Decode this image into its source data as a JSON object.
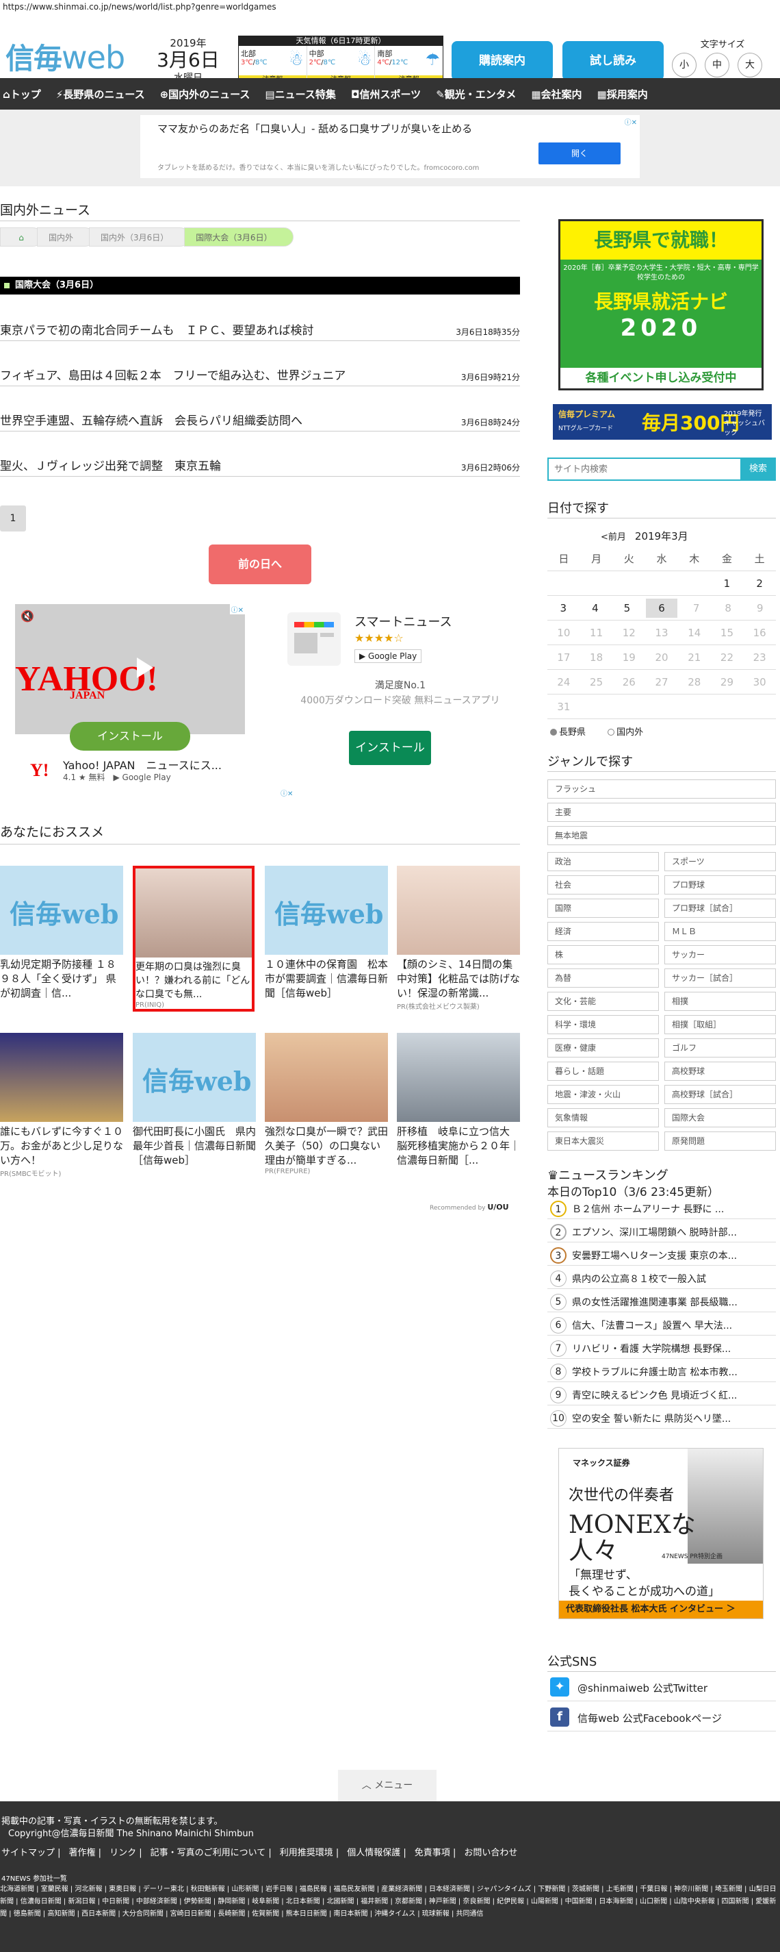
{
  "browser": {
    "url": "https://www.shinmai.co.jp/news/world/list.php?genre=worldgames"
  },
  "header": {
    "logo": "信毎",
    "logo_web": "web",
    "date": {
      "year": "2019年",
      "monthday": "3月6日",
      "weekday": "水曜日"
    },
    "weather": {
      "title": "天気情報（6日17時更新）",
      "regions": [
        {
          "name": "北部",
          "hi": "3℃",
          "lo": "8℃",
          "warn": "注意報"
        },
        {
          "name": "中部",
          "hi": "2℃",
          "lo": "8℃",
          "warn": "注意報"
        },
        {
          "name": "南部",
          "hi": "4℃",
          "lo": "12℃",
          "warn": "注意報"
        }
      ]
    },
    "subscribe": "購読案内",
    "trial": "試し読み",
    "fontsize": {
      "label": "文字サイズ",
      "small": "小",
      "medium": "中",
      "large": "大"
    }
  },
  "nav": [
    "トップ",
    "長野県のニュース",
    "国内外のニュース",
    "ニュース特集",
    "信州スポーツ",
    "観光・エンタメ",
    "会社案内",
    "採用案内"
  ],
  "ad_banner": {
    "title": "ママ友からのあだ名「口臭い人」- 舐める口臭サプリが臭いを止める",
    "sub": "タブレットを舐めるだけ。香りではなく、本当に臭いを消したい私にぴったりでした。fromcocoro.com",
    "cta": "開く"
  },
  "main": {
    "section_title": "国内外ニュース",
    "breadcrumbs": [
      "国内外",
      "国内外（3月6日）",
      "国際大会（3月6日）"
    ],
    "bar": "国際大会（3月6日）",
    "news": [
      {
        "title": "東京パラで初の南北合同チームも　ＩＰＣ、要望あれば検討",
        "time": "3月6日18時35分"
      },
      {
        "title": "フィギュア、島田は４回転２本　フリーで組み込む、世界ジュニア",
        "time": "3月6日9時21分"
      },
      {
        "title": "世界空手連盟、五輪存続へ直訴　会長らパリ組織委訪問へ",
        "time": "3月6日8時24分"
      },
      {
        "title": "聖火、Ｊヴィレッジ出発で調整　東京五輪",
        "time": "3月6日2時06分"
      }
    ],
    "page": "1",
    "prev_day": "前の日へ"
  },
  "ad2": {
    "yahoo_text": "YAHOO!",
    "yahoo_sub": "JAPAN",
    "install1": "インストール",
    "yahoo_app": "Yahoo! JAPAN　ニュースにス...",
    "yahoo_rating": "4.1 ★ 無料　▶ Google Play",
    "smart_name": "スマートニュース",
    "smart_stars": "★★★★☆",
    "smart_gp": "▶ Google Play",
    "smart_d1": "満足度No.1",
    "smart_d2": "4000万ダウンロード突破 無料ニュースアプリ",
    "install2": "インストール"
  },
  "recommend": {
    "title": "あなたにおススメ",
    "cards": [
      {
        "text": "乳幼児定期予防接種 １８９８人「全く受けず」 県が初調査｜信...",
        "pr": ""
      },
      {
        "text": "更年期の口臭は強烈に臭い！？嫌われる前に「どんな口臭でも無...",
        "pr": "PR(INIQ)"
      },
      {
        "text": "１０連休中の保育園　松本市が需要調査｜信濃毎日新聞［信毎web］",
        "pr": ""
      },
      {
        "text": "【顔のシミ、14日間の集中対策】化粧品では防げない！保湿の新常識...",
        "pr": "PR(株式会社メビウス製薬)"
      },
      {
        "text": "誰にもバレずに今すぐ１０万。お金があと少し足りない方へ！",
        "pr": "PR(SMBCモビット)"
      },
      {
        "text": "御代田町長に小園氏　県内最年少首長｜信濃毎日新聞［信毎web］",
        "pr": ""
      },
      {
        "text": "強烈な口臭が一瞬で？武田久美子（50）の口臭ない理由が簡単すぎる...",
        "pr": "PR(FREPURE)"
      },
      {
        "text": "肝移植　岐阜に立つ信大　脳死移植実施から２０年｜信濃毎日新聞［...",
        "pr": ""
      }
    ],
    "recommended_by": "Recommended by"
  },
  "side": {
    "shukatsu": {
      "top": "長野県で就職！",
      "mid1": "2020年［春］卒業予定の大学生・大学院・短大・高専・専門学校学生のための",
      "mid2": "長野県就活ナビ",
      "mid3": "2020",
      "bot": "各種イベント申し込み受付中"
    },
    "premium": {
      "a": "信毎プレミアム",
      "b": "NTTグループカード",
      "c": "毎月300円",
      "d": "2019年発行キャッシュバック"
    },
    "search_placeholder": "サイト内検索",
    "search_btn": "検索",
    "cal_title": "日付で探す",
    "cal_prev": "<前月",
    "cal_month": "2019年3月",
    "cal_days": [
      "日",
      "月",
      "火",
      "水",
      "木",
      "金",
      "土"
    ],
    "cal_rows": [
      [
        "",
        "",
        "",
        "",
        "",
        "1",
        "2"
      ],
      [
        "3",
        "4",
        "5",
        "6",
        "7",
        "8",
        "9"
      ],
      [
        "10",
        "11",
        "12",
        "13",
        "14",
        "15",
        "16"
      ],
      [
        "17",
        "18",
        "19",
        "20",
        "21",
        "22",
        "23"
      ],
      [
        "24",
        "25",
        "26",
        "27",
        "28",
        "29",
        "30"
      ],
      [
        "31",
        "",
        "",
        "",
        "",
        "",
        ""
      ]
    ],
    "radio1": "長野県",
    "radio2": "国内外",
    "genre_title": "ジャンルで探す",
    "genres_full": [
      "フラッシュ",
      "主要",
      "無本地震"
    ],
    "genres_pairs": [
      [
        "政治",
        "スポーツ"
      ],
      [
        "社会",
        "プロ野球"
      ],
      [
        "国際",
        "プロ野球［試合］"
      ],
      [
        "経済",
        "ＭＬＢ"
      ],
      [
        "株",
        "サッカー"
      ],
      [
        "為替",
        "サッカー［試合］"
      ],
      [
        "文化・芸能",
        "相撲"
      ],
      [
        "科学・環境",
        "相撲［取組］"
      ],
      [
        "医療・健康",
        "ゴルフ"
      ],
      [
        "暮らし・話題",
        "高校野球"
      ],
      [
        "地震・津波・火山",
        "高校野球［試合］"
      ],
      [
        "気象情報",
        "国際大会"
      ],
      [
        "東日本大震災",
        "原発問題"
      ]
    ],
    "ranking_title": "ニュースランキング",
    "ranking_sub": "本日のTop10（3/6 23:45更新）",
    "ranking": [
      "Ｂ２信州 ホームアリーナ 長野に ...",
      "エプソン、深川工場閉鎖へ 脱時計部...",
      "安曇野工場へＵターン支援 東京の本...",
      "県内の公立高８１校で一般入試",
      "県の女性活躍推進関連事業 部長級職...",
      "信大、「法曹コース」設置へ 早大法...",
      "リハビリ・看護 大学院構想 長野保...",
      "学校トラブルに弁護士助言 松本市教...",
      "青空に映えるピンク色 見頃近づく紅...",
      "空の安全 誓い新たに 県防災ヘリ墜..."
    ],
    "monex": {
      "logo": "マネックス証券",
      "m1": "次世代の伴奏者",
      "m2": "MONEXな",
      "m3": "人々",
      "m4": "47NEWS PR特別企画",
      "m5": "「無理せず、",
      "m6": "長くやることが成功への道」",
      "m7": "代表取締役社長 松本大氏 インタビュー ＞"
    },
    "sns_title": "公式SNS",
    "twitter": "@shinmaiweb 公式Twitter",
    "facebook": "信毎web 公式Facebookページ"
  },
  "menu": "メニュー",
  "footer": {
    "notice": "掲載中の記事・写真・イラストの無断転用を禁じます。",
    "copyright": "Copyright@信濃毎日新聞 The Shinano Mainichi Shimbun",
    "links": [
      "サイトマップ",
      "著作権",
      "リンク",
      "記事・写真のご利用について",
      "利用推奨環境",
      "個人情報保護",
      "免責事項",
      "お問い合わせ"
    ],
    "news47": "47NEWS 参加社一覧",
    "papers": "北海道新聞 | 室蘭民報 | 河北新報 | 東奥日報 | デーリー東北 | 秋田魁新報 | 山形新聞 | 岩手日報 | 福島民報 | 福島民友新聞 | 産業経済新聞 | 日本経済新聞 | ジャパンタイムズ | 下野新聞 | 茨城新聞 | 上毛新聞 | 千葉日報 | 神奈川新聞 | 埼玉新聞 | 山梨日日新聞 | 信濃毎日新聞 | 新潟日報 | 中日新聞 | 中部経済新聞 | 伊勢新聞 | 静岡新聞 | 岐阜新聞 | 北日本新聞 | 北國新聞 | 福井新聞 | 京都新聞 | 神戸新聞 | 奈良新聞 | 紀伊民報 | 山陽新聞 | 中国新聞 | 日本海新聞 | 山口新聞 | 山陰中央新報 | 四国新聞 | 愛媛新聞 | 徳島新聞 | 高知新聞 | 西日本新聞 | 大分合同新聞 | 宮崎日日新聞 | 長崎新聞 | 佐賀新聞 | 熊本日日新聞 | 南日本新聞 | 沖縄タイムス | 琉球新報 | 共同通信"
  }
}
